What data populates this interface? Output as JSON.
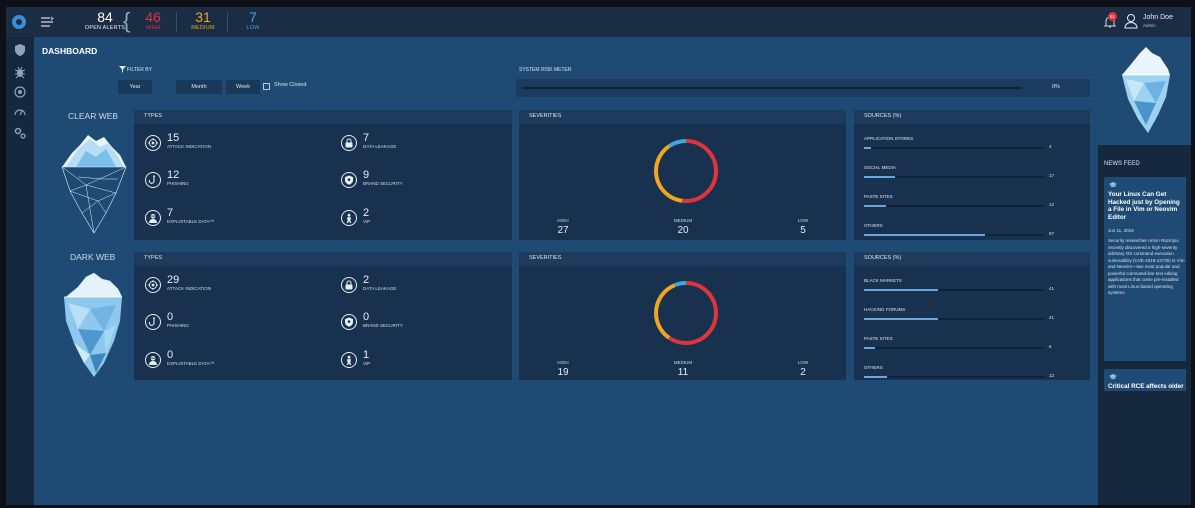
{
  "topbar": {
    "total_alerts": "84",
    "total_label": "OPEN ALERTS",
    "high": "46",
    "high_label": "HIGH",
    "medium": "31",
    "medium_label": "MEDIUM",
    "low": "7",
    "low_label": "LOW",
    "notification_count": "61",
    "user_name": "John Doe",
    "user_role": "Admin"
  },
  "page": {
    "title": "DASHBOARD"
  },
  "filter": {
    "label": "FILTER BY",
    "buttons": [
      "Year",
      "Month",
      "Week"
    ],
    "show_closed_label": "Show Closed"
  },
  "risk_meter": {
    "label": "SYSTEM RISK METER",
    "value": "0%",
    "fraction": 0
  },
  "clear_web": {
    "label": "CLEAR WEB",
    "types_title": "TYPES",
    "types": [
      {
        "count": "15",
        "label": "ATTACK INDICATION",
        "icon": "target-icon"
      },
      {
        "count": "7",
        "label": "DATA LEAKAGE",
        "icon": "lock-icon"
      },
      {
        "count": "12",
        "label": "PHISHING",
        "icon": "hook-icon"
      },
      {
        "count": "9",
        "label": "BRAND SECURITY",
        "icon": "shield-icon"
      },
      {
        "count": "7",
        "label": "EXPLOITABLE DATA™",
        "icon": "hacker-icon"
      },
      {
        "count": "2",
        "label": "VIP",
        "icon": "vip-icon"
      }
    ],
    "severities_title": "SEVERITIES",
    "severities": [
      {
        "label": "HIGH",
        "value": "27"
      },
      {
        "label": "MEDIUM",
        "value": "20"
      },
      {
        "label": "LOW",
        "value": "5"
      }
    ],
    "sources_title": "SOURCES (%)",
    "sources": [
      {
        "label": "APPLICATION STORES",
        "value": "4",
        "fraction": 0.04
      },
      {
        "label": "SOCIAL MEDIA",
        "value": "17",
        "fraction": 0.17
      },
      {
        "label": "PASTE SITES",
        "value": "12",
        "fraction": 0.12
      },
      {
        "label": "OTHERS",
        "value": "67",
        "fraction": 0.67
      }
    ]
  },
  "dark_web": {
    "label": "DARK WEB",
    "types_title": "TYPES",
    "types": [
      {
        "count": "29",
        "label": "ATTACK INDICATION",
        "icon": "target-icon"
      },
      {
        "count": "2",
        "label": "DATA LEAKAGE",
        "icon": "lock-icon"
      },
      {
        "count": "0",
        "label": "PHISHING",
        "icon": "hook-icon"
      },
      {
        "count": "0",
        "label": "BRAND SECURITY",
        "icon": "shield-icon"
      },
      {
        "count": "0",
        "label": "EXPLOITABLE DATA™",
        "icon": "hacker-icon"
      },
      {
        "count": "1",
        "label": "VIP",
        "icon": "vip-icon"
      }
    ],
    "severities_title": "SEVERITIES",
    "severities": [
      {
        "label": "HIGH",
        "value": "19"
      },
      {
        "label": "MEDIUM",
        "value": "11"
      },
      {
        "label": "LOW",
        "value": "2"
      }
    ],
    "sources_title": "SOURCES (%)",
    "sources": [
      {
        "label": "BLACK MARKETS",
        "value": "41",
        "fraction": 0.41
      },
      {
        "label": "HACKING FORUMS",
        "value": "41",
        "fraction": 0.41
      },
      {
        "label": "PASTE SITES",
        "value": "6",
        "fraction": 0.06
      },
      {
        "label": "OTHERS",
        "value": "13",
        "fraction": 0.13
      }
    ]
  },
  "news": {
    "title": "NEWS FEED",
    "items": [
      {
        "headline": "Your Linux Can Get Hacked just by Opening a File in Vim or Neovim Editor",
        "date": "Jun 11, 2019",
        "body": "Security researcher Armin Razmjou recently discovered a high-severity arbitrary OS command execution vulnerability (CVE-2019-12735) in Vim and Neovim—two most popular and powerful command-line text editing applications that come pre-installed with most Linux-based operating systems."
      },
      {
        "headline": "Critical RCE affects older",
        "date": "",
        "body": ""
      }
    ]
  },
  "colors": {
    "high": "#e0343c",
    "medium": "#f2a51f",
    "low": "#3fa6e0",
    "background": "#1f4a73",
    "panel": "#17314f"
  }
}
